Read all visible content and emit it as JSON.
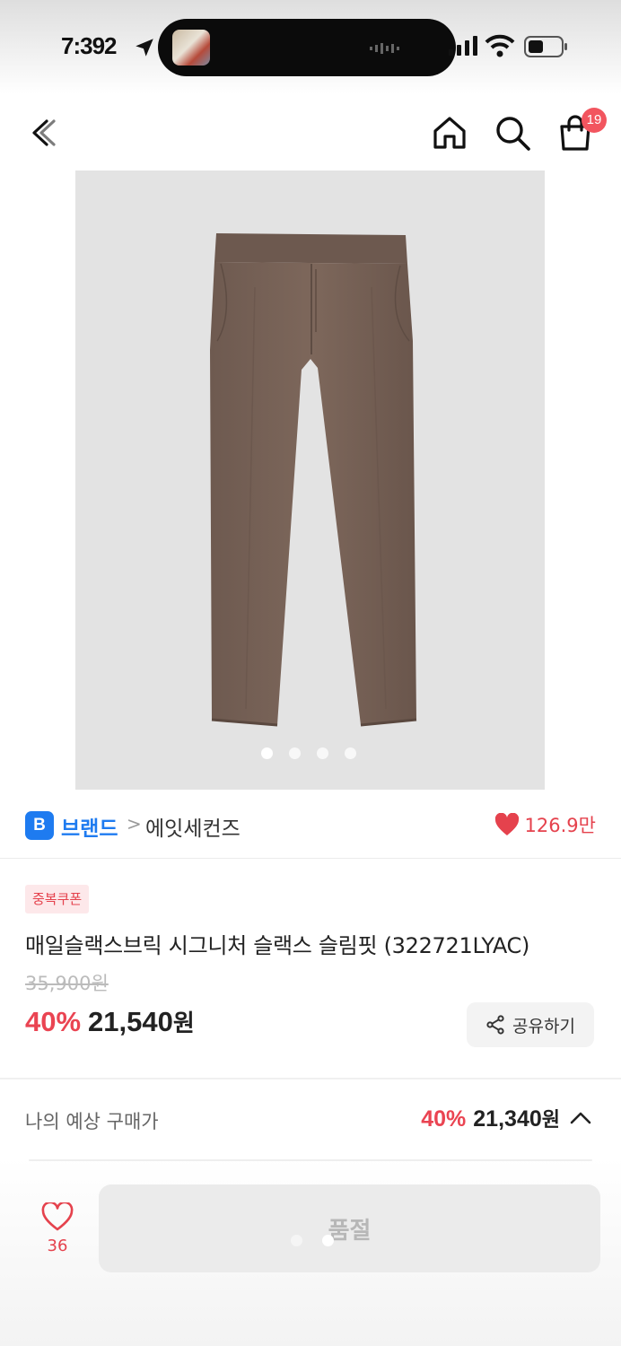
{
  "status_bar": {
    "time": "7:392"
  },
  "nav": {
    "cart_count": "19"
  },
  "product": {
    "brand_badge": "B",
    "brand_label": "브랜드",
    "crumb_separator": ">",
    "brand_name": "에잇세컨즈",
    "likes_total": "126.9만",
    "coupon_tag": "중복쿠폰",
    "title": "매일슬랙스브릭 시그니처 슬랙스 슬림핏 (322721LYAC)",
    "original_price": "35,900원",
    "discount": "40%",
    "price": "21,540",
    "price_unit": "원",
    "share_label": "공유하기",
    "image_page": 1,
    "image_count": 4
  },
  "expected": {
    "label": "나의 예상 구매가",
    "discount": "40%",
    "price": "21,340",
    "price_unit": "원"
  },
  "bottom": {
    "wish_count": "36",
    "soldout_label": "품절"
  },
  "colors": {
    "accent_red": "#ea4452",
    "brand_blue": "#1e7bf0",
    "badge_red": "#f2555f",
    "pants_brown": "#7a6559"
  },
  "icons": [
    "location-arrow-icon",
    "signal-icon",
    "wifi-icon",
    "battery-icon",
    "back-icon",
    "home-icon",
    "search-icon",
    "shopping-bag-icon",
    "heart-icon",
    "share-icon",
    "chevron-up-icon"
  ]
}
